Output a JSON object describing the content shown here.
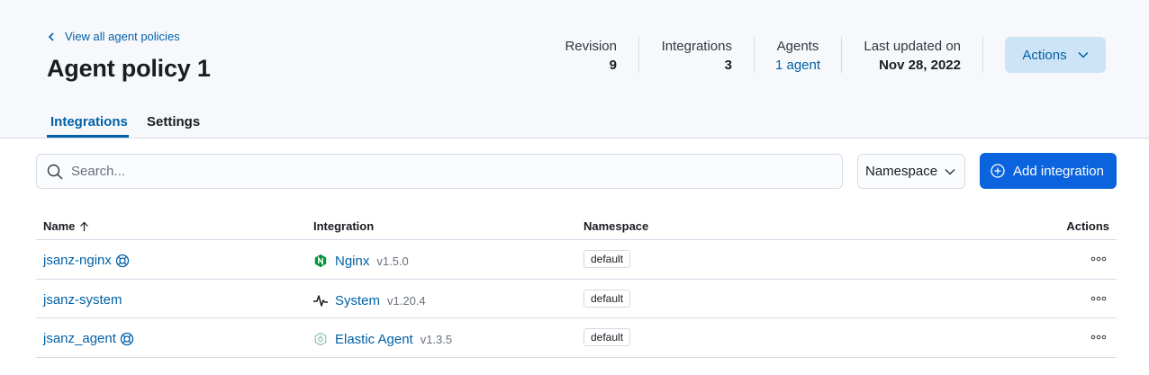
{
  "header": {
    "back_link": "View all agent policies",
    "title": "Agent policy 1",
    "stats": {
      "revision": {
        "label": "Revision",
        "value": "9"
      },
      "integrations": {
        "label": "Integrations",
        "value": "3"
      },
      "agents": {
        "label": "Agents",
        "value": "1 agent"
      },
      "last_updated": {
        "label": "Last updated on",
        "value": "Nov 28, 2022"
      }
    },
    "actions_label": "Actions"
  },
  "tabs": [
    {
      "label": "Integrations",
      "active": true
    },
    {
      "label": "Settings",
      "active": false
    }
  ],
  "toolbar": {
    "search_placeholder": "Search...",
    "namespace_label": "Namespace",
    "add_integration_label": "Add integration"
  },
  "table": {
    "columns": {
      "name": "Name",
      "integration": "Integration",
      "namespace": "Namespace",
      "actions": "Actions"
    },
    "rows": [
      {
        "name": "jsanz-nginx",
        "managed_icon": "lifebuoy-icon",
        "integration": "Nginx",
        "integration_icon": "nginx-icon",
        "version": "v1.5.0",
        "namespace": "default"
      },
      {
        "name": "jsanz-system",
        "managed_icon": "",
        "integration": "System",
        "integration_icon": "pulse-icon",
        "version": "v1.20.4",
        "namespace": "default"
      },
      {
        "name": "jsanz_agent",
        "managed_icon": "lifebuoy-icon",
        "integration": "Elastic Agent",
        "integration_icon": "elastic-agent-icon",
        "version": "v1.3.5",
        "namespace": "default"
      }
    ]
  },
  "colors": {
    "link": "#0061a6",
    "primary_button": "#0b64dd",
    "header_bg": "#f7f8fc",
    "actions_button_bg": "#cce4f5",
    "nginx_green": "#009639"
  }
}
